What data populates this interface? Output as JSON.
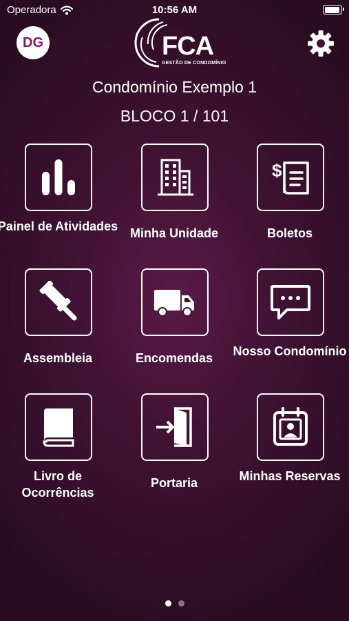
{
  "status_bar": {
    "carrier": "Operadora",
    "time": "10:56 AM"
  },
  "header": {
    "avatar_initials": "DG",
    "logo_text": "FCA",
    "logo_subtitle": "GESTÃO DE CONDOMÍNIO"
  },
  "condo": {
    "name": "Condomínio Exemplo 1",
    "unit": "BLOCO 1 / 101"
  },
  "menu": [
    {
      "label": "Painel de Atividades",
      "icon": "bar-chart-icon"
    },
    {
      "label": "Minha Unidade",
      "icon": "building-icon"
    },
    {
      "label": "Boletos",
      "icon": "invoice-icon"
    },
    {
      "label": "Assembleia",
      "icon": "gavel-icon"
    },
    {
      "label": "Encomendas",
      "icon": "delivery-truck-icon"
    },
    {
      "label": "Nosso Condomínio",
      "icon": "chat-bubble-icon"
    },
    {
      "label": "Livro de Ocorrências",
      "icon": "book-icon"
    },
    {
      "label": "Portaria",
      "icon": "door-enter-icon"
    },
    {
      "label": "Minhas Reservas",
      "icon": "calendar-user-icon"
    }
  ],
  "pagination": {
    "current_page": 1,
    "total_pages": 2
  },
  "colors": {
    "background": "#3e1232",
    "accent": "#7a1a63",
    "foreground": "#ffffff"
  }
}
